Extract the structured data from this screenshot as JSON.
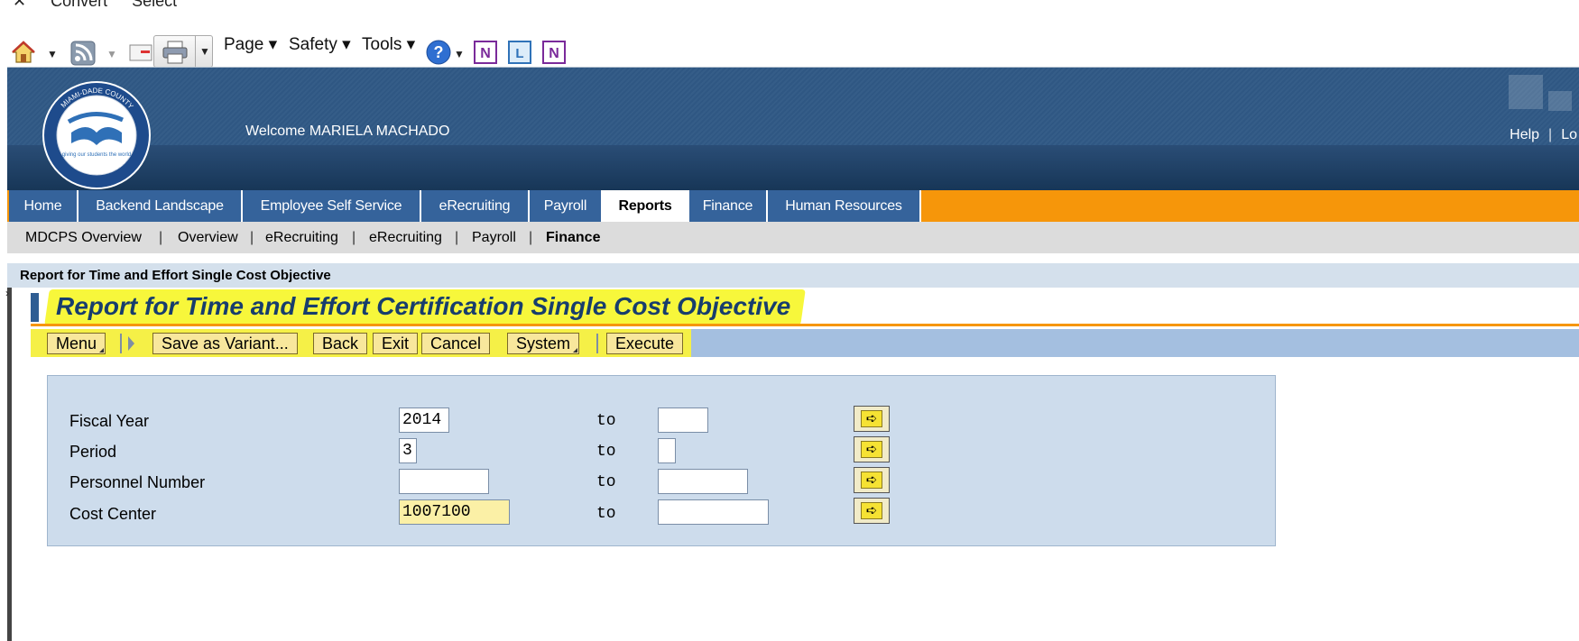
{
  "browser": {
    "top_items": [
      "Convert",
      "Select"
    ],
    "commands": {
      "page": "Page",
      "safety": "Safety",
      "tools": "Tools"
    }
  },
  "portal": {
    "logo_text": "MIAMI-DADE COUNTY PUBLIC SCHOOLS",
    "logo_motto": "giving our students the world",
    "welcome": "Welcome MARIELA MACHADO",
    "header_links": {
      "help": "Help",
      "logoff": "Lo"
    }
  },
  "tabs": [
    {
      "label": "Home"
    },
    {
      "label": "Backend Landscape"
    },
    {
      "label": "Employee Self Service"
    },
    {
      "label": "eRecruiting"
    },
    {
      "label": "Payroll"
    },
    {
      "label": "Reports",
      "active": true
    },
    {
      "label": "Finance"
    },
    {
      "label": "Human Resources"
    }
  ],
  "subnav": [
    {
      "label": "MDCPS Overview"
    },
    {
      "label": "Overview"
    },
    {
      "label": "eRecruiting"
    },
    {
      "label": "eRecruiting"
    },
    {
      "label": "Payroll"
    },
    {
      "label": "Finance",
      "current": true
    }
  ],
  "page": {
    "breadcrumb": "Report for Time and Effort Single Cost Objective",
    "title": "Report for Time and Effort Certification Single Cost Objective"
  },
  "toolbar": {
    "menu": "Menu",
    "save_variant": "Save as Variant...",
    "back": "Back",
    "exit": "Exit",
    "cancel": "Cancel",
    "system": "System",
    "execute": "Execute"
  },
  "form": {
    "to_label": "to",
    "rows": [
      {
        "label": "Fiscal Year",
        "from": "2014",
        "to": ""
      },
      {
        "label": "Period",
        "from": "3",
        "to": ""
      },
      {
        "label": "Personnel Number",
        "from": "",
        "to": ""
      },
      {
        "label": "Cost Center",
        "from": "1007100",
        "to": ""
      }
    ]
  },
  "colors": {
    "banner": "#2f5783",
    "tab": "#35639b",
    "tab_strip": "#f6960a",
    "highlight": "#f7f73b",
    "title_text": "#173d6d"
  }
}
